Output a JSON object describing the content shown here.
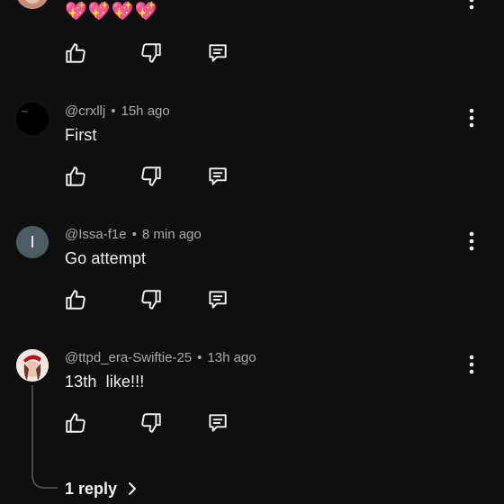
{
  "top_comment": {
    "emoji_text": "💖💖💖💖",
    "actions": {
      "like": "thumbs-up-icon",
      "dislike": "thumbs-down-icon",
      "reply": "comment-icon"
    }
  },
  "comments": [
    {
      "handle": "@crxllj",
      "time": "15h ago",
      "text": "First",
      "avatar_letter": ""
    },
    {
      "handle": "@Issa-f1e",
      "time": "8 min ago",
      "text": "Go attempt",
      "avatar_letter": "I"
    },
    {
      "handle": "@ttpd_era-Swiftie-25",
      "time": "13h ago",
      "text": "13th  like!!!",
      "avatar_letter": ""
    }
  ],
  "replies_link": {
    "label": "1 reply"
  },
  "separator": "•",
  "colors": {
    "background": "#0f0f0f",
    "text_primary": "#f1f1f1",
    "text_secondary": "#aaaaaa",
    "avatar_letter_bg": "#4f5b62"
  }
}
